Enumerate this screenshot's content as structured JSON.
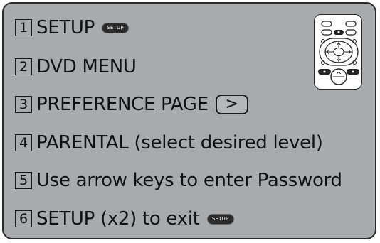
{
  "steps": [
    {
      "number": "1",
      "text": "SETUP",
      "button_label": "SETUP"
    },
    {
      "number": "2",
      "text": "DVD MENU"
    },
    {
      "number": "3",
      "text": "PREFERENCE PAGE",
      "key_symbol": ">"
    },
    {
      "number": "4",
      "text": "PARENTAL (select desired level)"
    },
    {
      "number": "5",
      "text": "Use arrow keys to enter Password"
    },
    {
      "number": "6",
      "text": "SETUP (x2) to exit",
      "button_label": "SETUP"
    }
  ],
  "colors": {
    "panel": "#a9aaac",
    "border": "#2a2a2a",
    "text": "#111111",
    "setup_button": "#2b2b2b"
  },
  "icons": {
    "remote": "remote-control-icon"
  }
}
